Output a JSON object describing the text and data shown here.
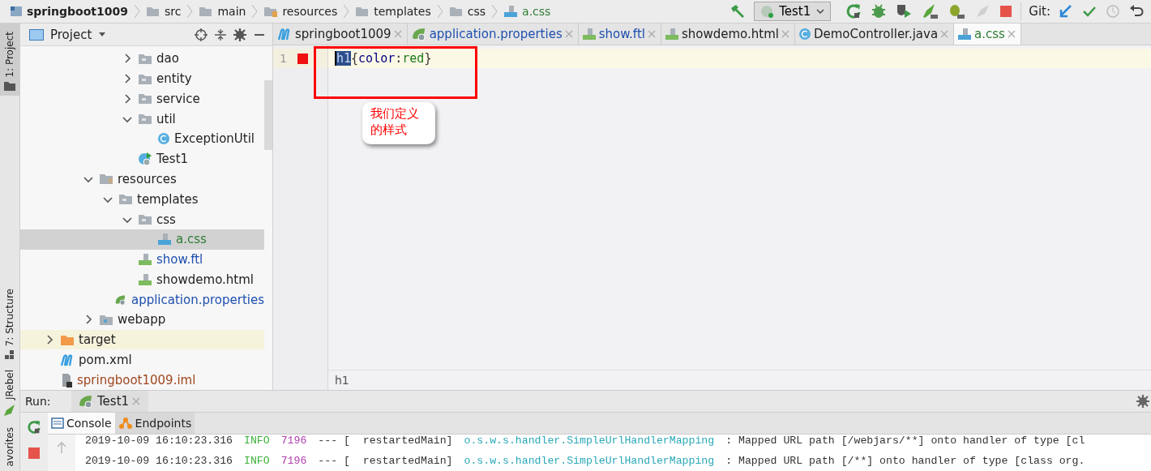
{
  "breadcrumbs": [
    {
      "label": "springboot1009",
      "kind": "module"
    },
    {
      "label": "src",
      "kind": "folder"
    },
    {
      "label": "main",
      "kind": "folder"
    },
    {
      "label": "resources",
      "kind": "resources"
    },
    {
      "label": "templates",
      "kind": "folder"
    },
    {
      "label": "css",
      "kind": "folder"
    },
    {
      "label": "a.css",
      "kind": "css",
      "color": "#2e7d32"
    }
  ],
  "toolbar": {
    "run_config": "Test1",
    "git_label": "Git:"
  },
  "tool_strip": [
    {
      "label": "1: Project",
      "kind": "project",
      "selected": true
    },
    {
      "label": "7: Structure",
      "kind": "structure",
      "selected": false
    },
    {
      "label": "JRebel",
      "kind": "jrebel",
      "selected": false
    },
    {
      "label": "avorites",
      "kind": "favorites",
      "selected": false
    }
  ],
  "project_panel": {
    "title": "Project"
  },
  "tree": [
    {
      "children": [
        {
          "children": [
            {
              "children": [
                {
                  "children": [
                    {
                      "label": "dao",
                      "kind": "folder",
                      "expanded": false,
                      "selected": false
                    },
                    {
                      "label": "entity",
                      "kind": "folder",
                      "expanded": false,
                      "selected": false
                    },
                    {
                      "label": "service",
                      "kind": "folder",
                      "expanded": false,
                      "selected": false
                    },
                    {
                      "label": "util",
                      "kind": "folder",
                      "expanded": true,
                      "selected": false,
                      "children": [
                        {
                          "label": "ExceptionUtil",
                          "kind": "class",
                          "selected": false
                        }
                      ]
                    },
                    {
                      "label": "Test1",
                      "kind": "boot",
                      "selected": false
                    }
                  ]
                }
              ]
            },
            {
              "label": "resources",
              "kind": "resources",
              "expanded": true,
              "selected": false,
              "children": [
                {
                  "label": "templates",
                  "kind": "folder",
                  "expanded": true,
                  "selected": false,
                  "children": [
                    {
                      "label": "css",
                      "kind": "folder",
                      "expanded": true,
                      "selected": false,
                      "children": [
                        {
                          "label": "a.css",
                          "kind": "css",
                          "selected": true,
                          "color": "#2e7d32"
                        }
                      ]
                    },
                    {
                      "label": "show.ftl",
                      "kind": "ftl",
                      "selected": false,
                      "color": "#1e4fb0"
                    },
                    {
                      "label": "showdemo.html",
                      "kind": "html",
                      "selected": false
                    }
                  ]
                },
                {
                  "label": "application.properties",
                  "kind": "properties",
                  "selected": false,
                  "color": "#1e4fb0"
                }
              ]
            },
            {
              "label": "webapp",
              "kind": "web",
              "expanded": false,
              "selected": false
            }
          ]
        }
      ]
    },
    {
      "label": "target",
      "kind": "excluded",
      "expanded": false,
      "selected": false,
      "excluded": true
    },
    {
      "label": "pom.xml",
      "kind": "maven",
      "selected": false
    },
    {
      "label": "springboot1009.iml",
      "kind": "iml",
      "selected": false,
      "color": "#a0461e"
    }
  ],
  "editor_tabs": [
    {
      "label": "springboot1009",
      "kind": "maven",
      "selected": false
    },
    {
      "label": "application.properties",
      "kind": "properties",
      "selected": false,
      "color": "#1e4fb0"
    },
    {
      "label": "show.ftl",
      "kind": "ftl",
      "selected": false,
      "color": "#1e4fb0"
    },
    {
      "label": "showdemo.html",
      "kind": "html",
      "selected": false
    },
    {
      "label": "DemoController.java",
      "kind": "class",
      "selected": false
    },
    {
      "label": "a.css",
      "kind": "css",
      "selected": true,
      "color": "#2e7d32"
    }
  ],
  "editor": {
    "lines": [
      {
        "number": "1",
        "breakpoint": true,
        "current": true,
        "tokens": [
          {
            "text": "h1",
            "kind": "selector",
            "selected": true
          },
          {
            "text": "{",
            "kind": "punct",
            "selected": false
          },
          {
            "text": "color",
            "kind": "property",
            "selected": false
          },
          {
            "text": ":",
            "kind": "punct",
            "selected": false
          },
          {
            "text": "red",
            "kind": "value",
            "selected": false
          },
          {
            "text": "}",
            "kind": "punct",
            "selected": false
          }
        ]
      }
    ],
    "breadcrumb": "h1"
  },
  "annotation": {
    "text": "我们定义的样式"
  },
  "run_panel": {
    "label": "Run:",
    "tab": "Test1",
    "console_tabs": [
      {
        "label": "Console",
        "kind": "console",
        "selected": true
      },
      {
        "label": "Endpoints",
        "kind": "endpoints",
        "selected": false
      }
    ],
    "lines": [
      [
        {
          "text": "2019-10-09 16:10:23.316",
          "kind": "time"
        },
        {
          "text": "INFO",
          "kind": "level"
        },
        {
          "text": "7196",
          "kind": "pid"
        },
        {
          "text": "--- [  restartedMain]",
          "kind": "thread"
        },
        {
          "text": "o.s.w.s.handler.SimpleUrlHandlerMapping",
          "kind": "logger"
        },
        {
          "text": ": Mapped URL path [/webjars/**] onto handler of type [cl",
          "kind": "message"
        }
      ],
      [
        {
          "text": "2019-10-09 16:10:23.316",
          "kind": "time"
        },
        {
          "text": "INFO",
          "kind": "level"
        },
        {
          "text": "7196",
          "kind": "pid"
        },
        {
          "text": "--- [  restartedMain]",
          "kind": "thread"
        },
        {
          "text": "o.s.w.s.handler.SimpleUrlHandlerMapping",
          "kind": "logger"
        },
        {
          "text": ": Mapped URL path [/**] onto handler of type [class org.",
          "kind": "message"
        }
      ]
    ]
  }
}
